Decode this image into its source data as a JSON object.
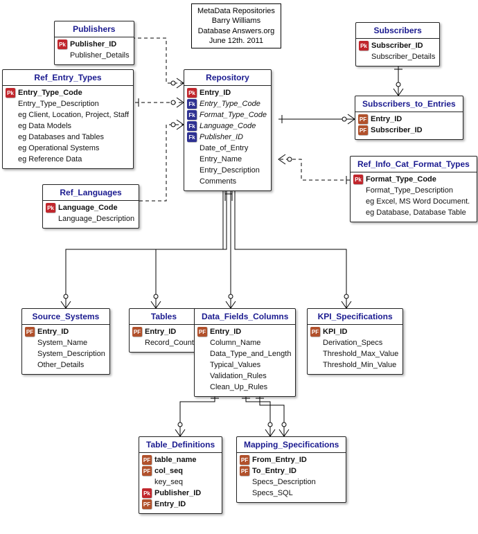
{
  "title_box": {
    "line1": "MetaData Repositories",
    "line2": "Barry Williams",
    "line3": "Database Answers.org",
    "line4": "June 12th. 2011"
  },
  "entities": {
    "publishers": {
      "name": "Publishers",
      "rows": [
        {
          "key": "pk",
          "text": "Publisher_ID",
          "style": "bold"
        },
        {
          "key": "none",
          "text": "Publisher_Details"
        }
      ]
    },
    "ref_entry_types": {
      "name": "Ref_Entry_Types",
      "rows": [
        {
          "key": "pk",
          "text": "Entry_Type_Code",
          "style": "bold"
        },
        {
          "key": "none",
          "text": "Entry_Type_Description"
        },
        {
          "key": "none",
          "text": "eg Client, Location, Project, Staff"
        },
        {
          "key": "none",
          "text": "eg Data Models"
        },
        {
          "key": "none",
          "text": "eg Databases and Tables"
        },
        {
          "key": "none",
          "text": "eg Operational Systems"
        },
        {
          "key": "none",
          "text": "eg Reference Data"
        }
      ]
    },
    "ref_languages": {
      "name": "Ref_Languages",
      "rows": [
        {
          "key": "pk",
          "text": "Language_Code",
          "style": "bold"
        },
        {
          "key": "none",
          "text": "Language_Description"
        }
      ]
    },
    "repository": {
      "name": "Repository",
      "rows": [
        {
          "key": "pk",
          "text": "Entry_ID",
          "style": "bold"
        },
        {
          "key": "fk",
          "text": "Entry_Type_Code",
          "style": "italic"
        },
        {
          "key": "fk",
          "text": "Format_Type_Code",
          "style": "italic"
        },
        {
          "key": "fk",
          "text": "Language_Code",
          "style": "italic"
        },
        {
          "key": "fk",
          "text": "Publisher_ID",
          "style": "italic"
        },
        {
          "key": "none",
          "text": "Date_of_Entry"
        },
        {
          "key": "none",
          "text": "Entry_Name"
        },
        {
          "key": "none",
          "text": "Entry_Description"
        },
        {
          "key": "none",
          "text": "Comments"
        }
      ]
    },
    "subscribers": {
      "name": "Subscribers",
      "rows": [
        {
          "key": "pk",
          "text": "Subscriber_ID",
          "style": "bold"
        },
        {
          "key": "none",
          "text": "Subscriber_Details"
        }
      ]
    },
    "subscribers_to_entries": {
      "name": "Subscribers_to_Entries",
      "rows": [
        {
          "key": "pf",
          "text": "Entry_ID",
          "style": "bold"
        },
        {
          "key": "pf",
          "text": "Subscriber_ID",
          "style": "bold"
        }
      ]
    },
    "ref_info_cat_format_types": {
      "name": "Ref_Info_Cat_Format_Types",
      "rows": [
        {
          "key": "pk",
          "text": "Format_Type_Code",
          "style": "bold"
        },
        {
          "key": "none",
          "text": "Format_Type_Description"
        },
        {
          "key": "none",
          "text": "eg Excel, MS Word Document."
        },
        {
          "key": "none",
          "text": "eg Database, Database Table"
        }
      ]
    },
    "source_systems": {
      "name": "Source_Systems",
      "rows": [
        {
          "key": "pf",
          "text": "Entry_ID",
          "style": "bold"
        },
        {
          "key": "none",
          "text": "System_Name"
        },
        {
          "key": "none",
          "text": "System_Description"
        },
        {
          "key": "none",
          "text": "Other_Details"
        }
      ]
    },
    "tables": {
      "name": "Tables",
      "rows": [
        {
          "key": "pf",
          "text": "Entry_ID",
          "style": "bold"
        },
        {
          "key": "none",
          "text": "Record_Count"
        }
      ]
    },
    "data_fields_columns": {
      "name": "Data_Fields_Columns",
      "rows": [
        {
          "key": "pf",
          "text": "Entry_ID",
          "style": "bold"
        },
        {
          "key": "none",
          "text": "Column_Name"
        },
        {
          "key": "none",
          "text": "Data_Type_and_Length"
        },
        {
          "key": "none",
          "text": "Typical_Values"
        },
        {
          "key": "none",
          "text": "Validation_Rules"
        },
        {
          "key": "none",
          "text": "Clean_Up_Rules"
        }
      ]
    },
    "kpi_specifications": {
      "name": "KPI_Specifications",
      "rows": [
        {
          "key": "pf",
          "text": "KPI_ID",
          "style": "bold"
        },
        {
          "key": "none",
          "text": "Derivation_Specs"
        },
        {
          "key": "none",
          "text": "Threshold_Max_Value"
        },
        {
          "key": "none",
          "text": "Threshold_Min_Value"
        }
      ]
    },
    "table_definitions": {
      "name": "Table_Definitions",
      "rows": [
        {
          "key": "pf",
          "text": "table_name",
          "style": "bold"
        },
        {
          "key": "pf",
          "text": "col_seq",
          "style": "bold"
        },
        {
          "key": "none",
          "text": "key_seq"
        },
        {
          "key": "pk",
          "text": "Publisher_ID",
          "style": "bold"
        },
        {
          "key": "pf",
          "text": "Entry_ID",
          "style": "bold"
        }
      ]
    },
    "mapping_specifications": {
      "name": "Mapping_Specifications",
      "rows": [
        {
          "key": "pf",
          "text": "From_Entry_ID",
          "style": "bold"
        },
        {
          "key": "pf",
          "text": "To_Entry_ID",
          "style": "bold"
        },
        {
          "key": "none",
          "text": "Specs_Description"
        },
        {
          "key": "none",
          "text": "Specs_SQL"
        }
      ]
    }
  }
}
